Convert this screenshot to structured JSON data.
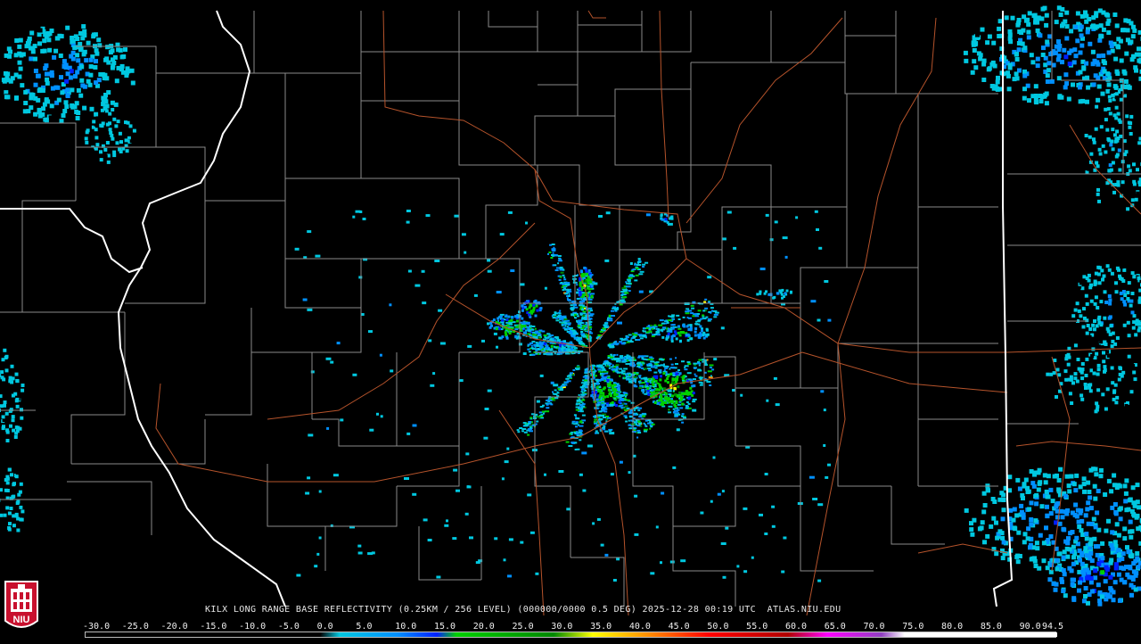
{
  "product": {
    "text": "KILX LONG RANGE BASE REFLECTIVITY (0.25KM / 256 LEVEL) (000000/0000 0.5 DEG) 2025-12-28 00:19 UTC  ATLAS.NIU.EDU"
  },
  "logo": {
    "text": "NIU"
  },
  "colorbar": {
    "labels": [
      "-30.0",
      "-25.0",
      "-20.0",
      "-15.0",
      "-10.0",
      "-5.0",
      "0.0",
      "5.0",
      "10.0",
      "15.0",
      "20.0",
      "25.0",
      "30.0",
      "35.0",
      "40.0",
      "45.0",
      "50.0",
      "55.0",
      "60.0",
      "65.0",
      "70.0",
      "75.0",
      "80.0",
      "85.0",
      "90.0",
      "94.5"
    ],
    "min": -30.0,
    "max": 94.5,
    "stops": [
      {
        "dbz": -30,
        "color": "#000000"
      },
      {
        "dbz": 0,
        "color": "#000000"
      },
      {
        "dbz": 2.5,
        "color": "#00c8e0"
      },
      {
        "dbz": 10,
        "color": "#0090ff"
      },
      {
        "dbz": 15,
        "color": "#0020ff"
      },
      {
        "dbz": 17.5,
        "color": "#00d000"
      },
      {
        "dbz": 30,
        "color": "#008800"
      },
      {
        "dbz": 35,
        "color": "#ffff00"
      },
      {
        "dbz": 42,
        "color": "#ff9000"
      },
      {
        "dbz": 50,
        "color": "#ff0000"
      },
      {
        "dbz": 60,
        "color": "#b00000"
      },
      {
        "dbz": 65,
        "color": "#ff00ff"
      },
      {
        "dbz": 72,
        "color": "#9040c0"
      },
      {
        "dbz": 75,
        "color": "#ffffff"
      },
      {
        "dbz": 94.5,
        "color": "#ffffff"
      }
    ]
  },
  "colors": {
    "background": "#000000",
    "county_lines": "#8a8a8a",
    "state_lines": "#ffffff",
    "highways": "#b5532b",
    "echo_light": "#00c8e0",
    "echo_moderate": "#0090ff",
    "echo_heavy": "#0020ff"
  },
  "radar": {
    "site": "KILX",
    "center_lon": -89.34,
    "center_lat": 40.15
  }
}
